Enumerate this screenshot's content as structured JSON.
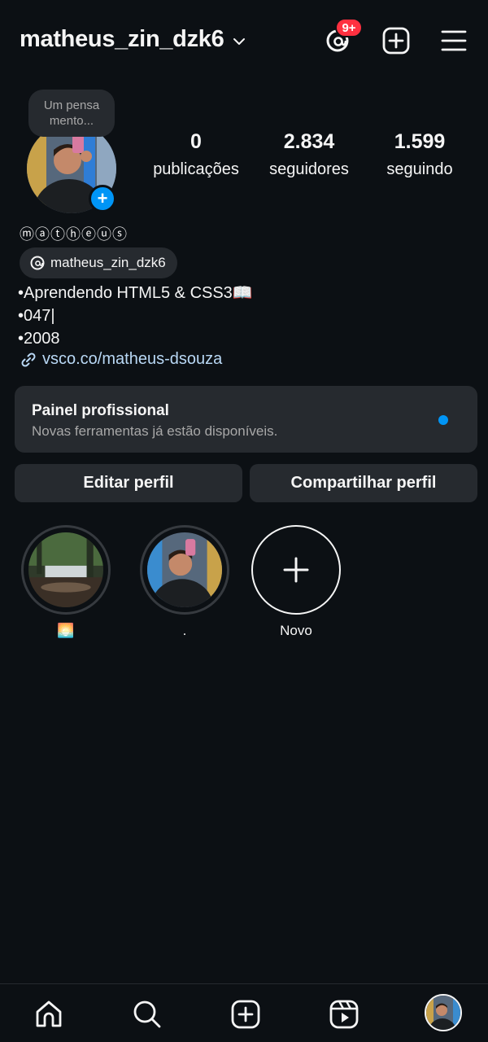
{
  "header": {
    "username": "matheus_zin_dzk6",
    "notification_badge": "9+",
    "icons": [
      "chevron-down-icon",
      "threads-icon",
      "new-post-icon",
      "menu-icon"
    ]
  },
  "profile": {
    "note": "Um pensa mento...",
    "display_name": "ⓜⓐⓣⓗⓔⓤⓢ",
    "stats": {
      "posts": {
        "value": "0",
        "label": "publicações"
      },
      "followers": {
        "value": "2.834",
        "label": "seguidores"
      },
      "following": {
        "value": "1.599",
        "label": "seguindo"
      }
    },
    "threads_handle": "matheus_zin_dzk6",
    "bio": [
      "•Aprendendo HTML5 & CSS3📖",
      "•047|",
      "•2008"
    ],
    "link": "vsco.co/matheus-dsouza"
  },
  "professional_panel": {
    "title": "Painel profissional",
    "subtitle": "Novas ferramentas já estão disponíveis."
  },
  "buttons": {
    "edit": "Editar perfil",
    "share": "Compartilhar perfil"
  },
  "highlights": [
    {
      "label": "🌅"
    },
    {
      "label": "."
    },
    {
      "label": "Novo"
    }
  ],
  "bottom_nav": [
    "home-icon",
    "search-icon",
    "create-icon",
    "reels-icon",
    "profile-avatar"
  ],
  "colors": {
    "background": "#0c1014",
    "surface": "#262a2f",
    "accent": "#0095f6",
    "badge": "#ff3040",
    "link": "#b9d8f5"
  }
}
